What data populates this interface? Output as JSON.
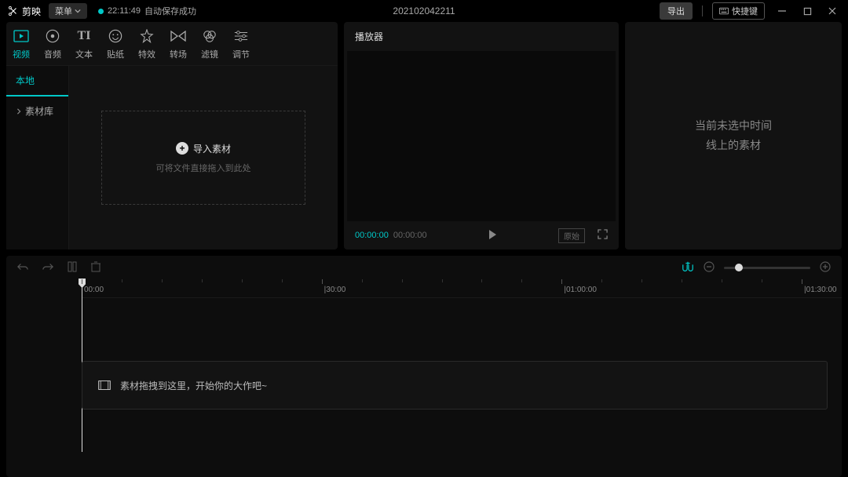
{
  "titlebar": {
    "app_name": "剪映",
    "menu_label": "菜单",
    "autosave_time": "22:11:49",
    "autosave_text": "自动保存成功",
    "project_title": "202102042211",
    "export_label": "导出",
    "shortcut_label": "快捷键"
  },
  "media_tabs": [
    {
      "label": "视频",
      "icon": "video-icon",
      "active": true
    },
    {
      "label": "音频",
      "icon": "audio-icon"
    },
    {
      "label": "文本",
      "icon": "text-icon"
    },
    {
      "label": "贴纸",
      "icon": "sticker-icon"
    },
    {
      "label": "特效",
      "icon": "effect-icon"
    },
    {
      "label": "转场",
      "icon": "transition-icon"
    },
    {
      "label": "滤镜",
      "icon": "filter-icon"
    },
    {
      "label": "调节",
      "icon": "adjust-icon"
    }
  ],
  "media_side": {
    "local": "本地",
    "library": "素材库"
  },
  "import": {
    "button": "导入素材",
    "hint": "可将文件直接拖入到此处"
  },
  "player": {
    "title": "播放器",
    "time_current": "00:00:00",
    "time_total": "00:00:00",
    "ratio_label": "原始"
  },
  "inspector": {
    "empty_line1": "当前未选中时间",
    "empty_line2": "线上的素材"
  },
  "ruler": {
    "marks": [
      "00:00",
      "|30:00",
      "|01:00:00",
      "|01:30:00"
    ]
  },
  "timeline": {
    "hint": "素材拖拽到这里，开始你的大作吧~"
  }
}
